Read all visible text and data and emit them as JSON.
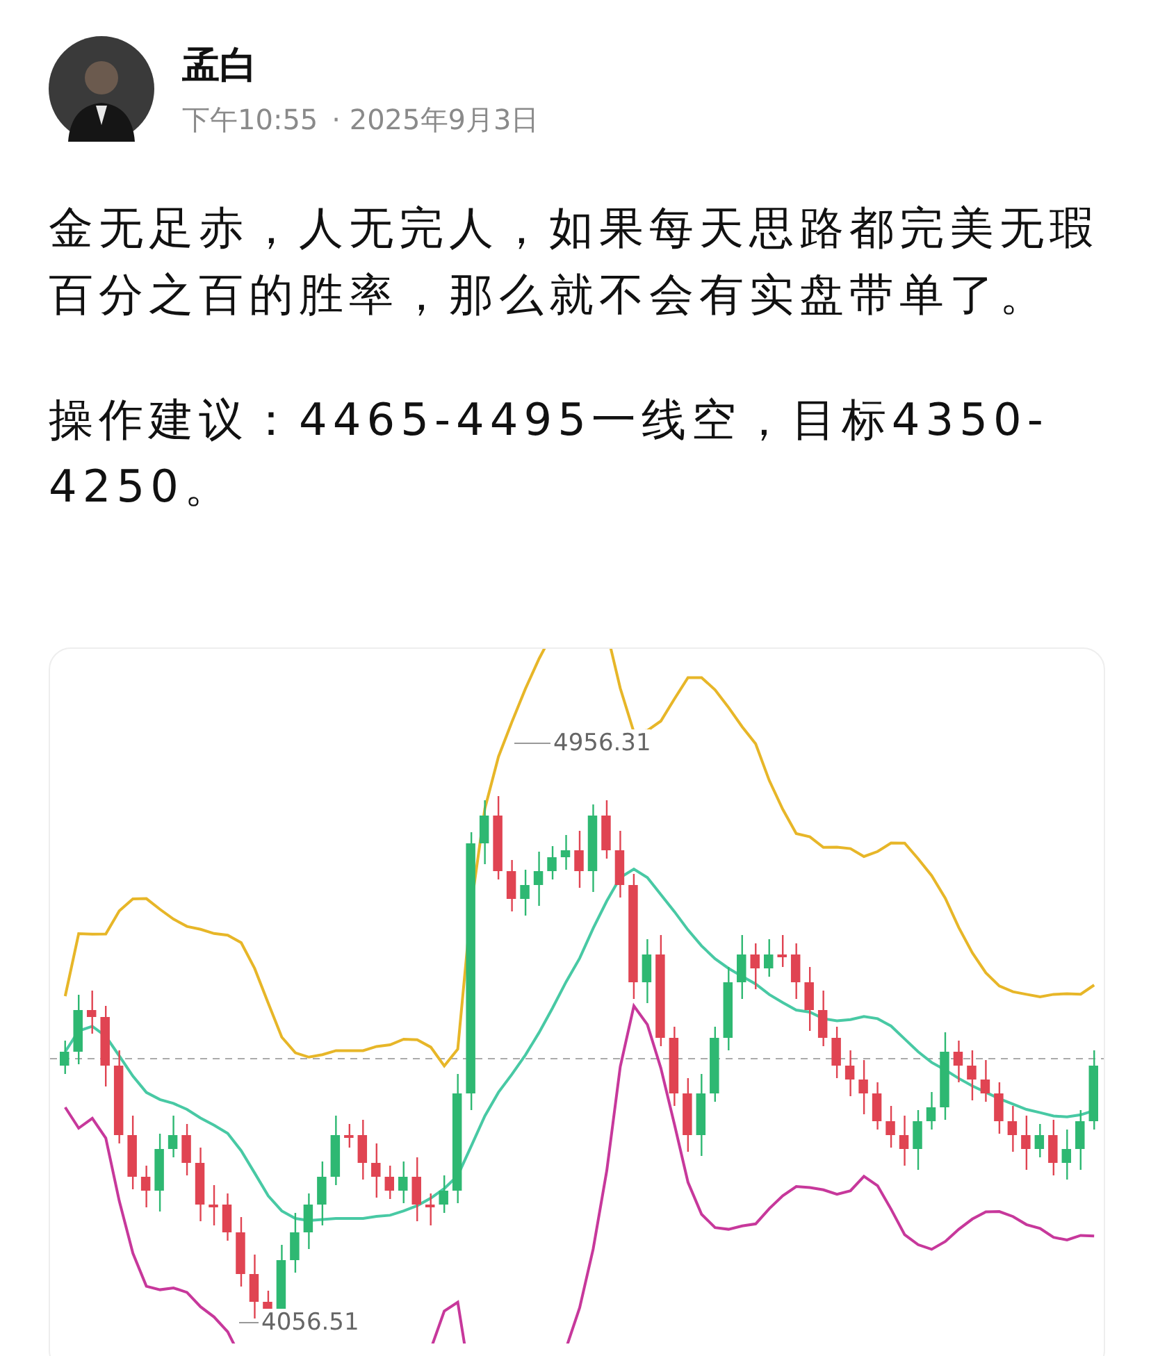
{
  "post": {
    "author": "孟白",
    "time": "下午10:55",
    "date": "· 2025年9月3日",
    "paragraphs": [
      "金无足赤，人无完人，如果每天思路都完美无瑕百分之百的胜率，那么就不会有实盘带单了。",
      "操作建议：4465-4495一线空，目标4350-4250。"
    ]
  },
  "chart": {
    "high_label": "4956.31",
    "low_label": "4056.51"
  }
}
